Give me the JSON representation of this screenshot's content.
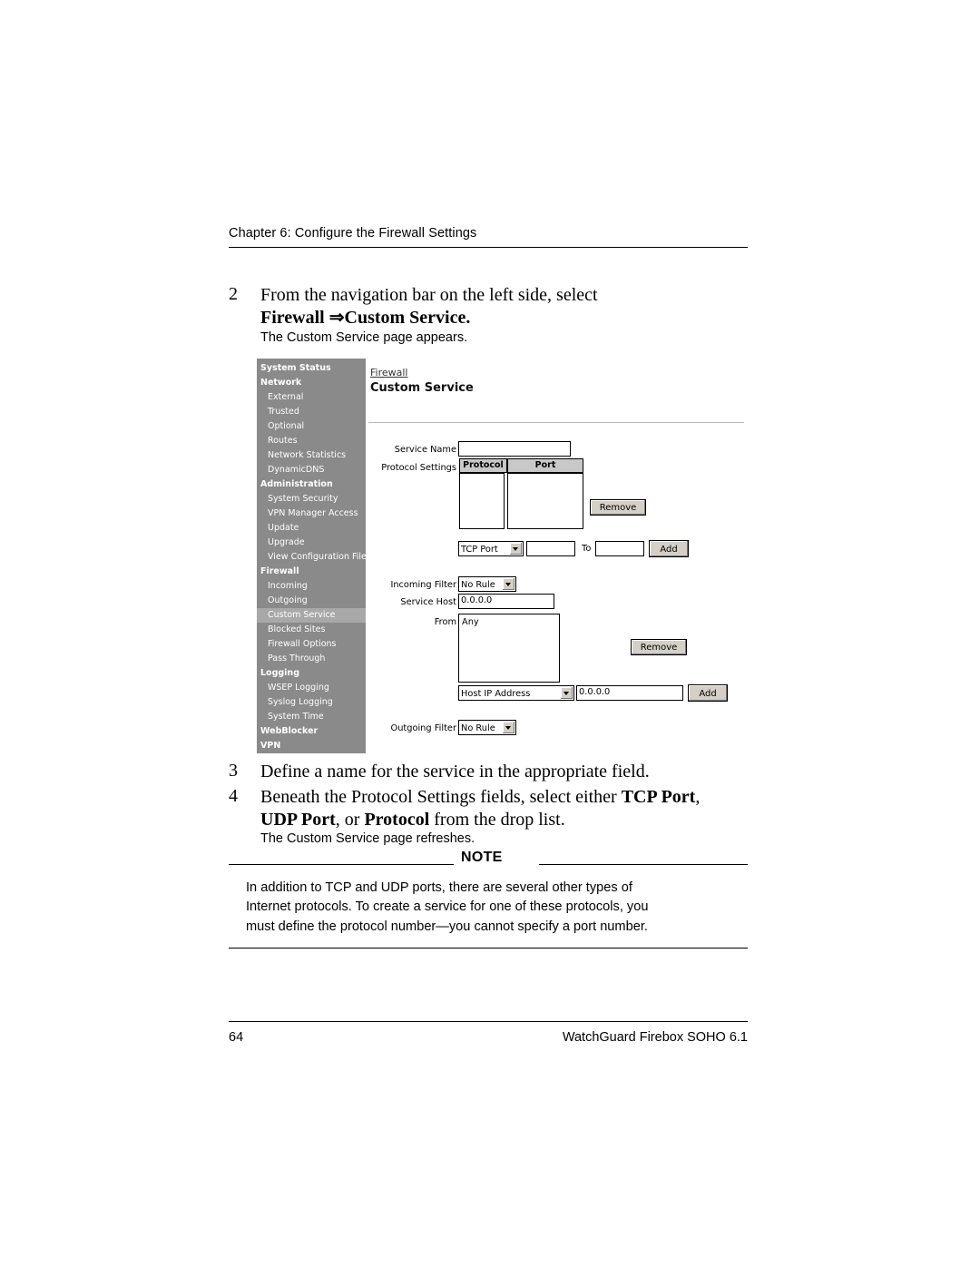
{
  "header": {
    "chapter": "Chapter 6: Configure the Firewall Settings"
  },
  "steps": [
    {
      "num": "2",
      "line1": "From the navigation bar on the left side, select",
      "line2_bold_a": "Firewall ",
      "line2_arrow": "⇒",
      "line2_bold_b": "Custom Service",
      "line2_end": ".",
      "note": "The Custom Service page appears."
    },
    {
      "num": "3",
      "line1": "Define a name for the service in the appropriate field."
    },
    {
      "num": "4",
      "line1a": "Beneath the Protocol Settings fields, select either ",
      "line1b": "TCP Port",
      "line1c": ",",
      "line2a": "UDP Port",
      "line2b": ", or ",
      "line2c": "Protocol",
      "line2d": " from the drop list.",
      "note": "The Custom Service page refreshes."
    }
  ],
  "note_block": {
    "label": "NOTE",
    "line1": "In addition to TCP and UDP ports, there are several other types of",
    "line2": "Internet protocols. To create a service for one of these protocols, you",
    "line3": "must define the protocol number—you cannot specify a port number."
  },
  "footer": {
    "page_number": "64",
    "product": "WatchGuard Firebox SOHO 6.1"
  },
  "figure": {
    "nav": [
      {
        "label": "System Status",
        "type": "group"
      },
      {
        "label": "Network",
        "type": "group"
      },
      {
        "label": "External",
        "type": "child"
      },
      {
        "label": "Trusted",
        "type": "child"
      },
      {
        "label": "Optional",
        "type": "child"
      },
      {
        "label": "Routes",
        "type": "child"
      },
      {
        "label": "Network Statistics",
        "type": "child"
      },
      {
        "label": "DynamicDNS",
        "type": "child"
      },
      {
        "label": "Administration",
        "type": "group"
      },
      {
        "label": "System Security",
        "type": "child"
      },
      {
        "label": "VPN Manager Access",
        "type": "child"
      },
      {
        "label": "Update",
        "type": "child"
      },
      {
        "label": "Upgrade",
        "type": "child"
      },
      {
        "label": "View Configuration File",
        "type": "child"
      },
      {
        "label": "Firewall",
        "type": "group"
      },
      {
        "label": "Incoming",
        "type": "child"
      },
      {
        "label": "Outgoing",
        "type": "child"
      },
      {
        "label": "Custom Service",
        "type": "child-selected"
      },
      {
        "label": "Blocked Sites",
        "type": "child"
      },
      {
        "label": "Firewall Options",
        "type": "child"
      },
      {
        "label": "Pass Through",
        "type": "child"
      },
      {
        "label": "Logging",
        "type": "group"
      },
      {
        "label": "WSEP Logging",
        "type": "child"
      },
      {
        "label": "Syslog Logging",
        "type": "child"
      },
      {
        "label": "System Time",
        "type": "child"
      },
      {
        "label": "WebBlocker",
        "type": "group"
      },
      {
        "label": "VPN",
        "type": "group"
      }
    ],
    "breadcrumb": "Firewall",
    "title": "Custom Service",
    "fields": {
      "service_name_label": "Service Name",
      "service_name_value": "",
      "protocol_settings_label": "Protocol Settings",
      "col_protocol": "Protocol",
      "col_port": "Port",
      "remove_protocol_button": "Remove",
      "port_type_value": "TCP Port",
      "port_from_value": "",
      "to_label": "To",
      "port_to_value": "",
      "add_protocol_button": "Add",
      "incoming_filter_label": "Incoming Filter",
      "incoming_filter_value": "No Rule",
      "service_host_label": "Service Host",
      "service_host_value": "0.0.0.0",
      "from_label": "From",
      "from_list_value": "Any",
      "remove_from_button": "Remove",
      "host_type_value": "Host IP Address",
      "host_ip_value": "0.0.0.0",
      "add_from_button": "Add",
      "outgoing_filter_label": "Outgoing Filter",
      "outgoing_filter_value": "No Rule"
    }
  }
}
